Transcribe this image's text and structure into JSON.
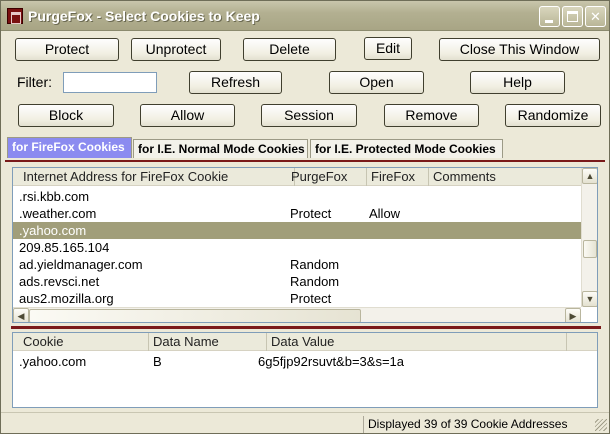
{
  "window": {
    "title": "PurgeFox - Select Cookies to Keep"
  },
  "toolbar_row1": [
    "Protect",
    "Unprotect",
    "Delete",
    "Edit",
    "Close This Window"
  ],
  "filter": {
    "label": "Filter:",
    "value": ""
  },
  "toolbar_row2": [
    "Refresh",
    "Open",
    "Help"
  ],
  "toolbar_row3": [
    "Block",
    "Allow",
    "Session",
    "Remove",
    "Randomize"
  ],
  "tabs": [
    "for FireFox Cookies",
    "for I.E. Normal Mode Cookies",
    "for I.E. Protected Mode Cookies"
  ],
  "cookie_list": {
    "columns": [
      "Internet Address for FireFox Cookie",
      "PurgeFox",
      "FireFox",
      "Comments"
    ],
    "rows": [
      {
        "address": ".rsi.kbb.com",
        "purgefox": "",
        "firefox": ""
      },
      {
        "address": ".weather.com",
        "purgefox": "Protect",
        "firefox": "Allow"
      },
      {
        "address": ".yahoo.com",
        "purgefox": "",
        "firefox": "",
        "selected": true
      },
      {
        "address": "209.85.165.104",
        "purgefox": "",
        "firefox": ""
      },
      {
        "address": "ad.yieldmanager.com",
        "purgefox": "Random",
        "firefox": ""
      },
      {
        "address": "ads.revsci.net",
        "purgefox": "Random",
        "firefox": ""
      },
      {
        "address": "aus2.mozilla.org",
        "purgefox": "Protect",
        "firefox": ""
      }
    ]
  },
  "detail_list": {
    "columns": [
      "Cookie",
      "Data Name",
      "Data Value"
    ],
    "rows": [
      {
        "cookie": ".yahoo.com",
        "name": "B",
        "value": "6g5fjp92rsuvt&b=3&s=1a"
      }
    ]
  },
  "status": {
    "text": "Displayed 39 of 39 Cookie Addresses"
  },
  "scrollbar_glyphs": {
    "up": "▲",
    "down": "▼",
    "left": "◀",
    "right": "▶"
  },
  "colors": {
    "active_tab": "#8b8bf0",
    "selected_row": "#a19e7a",
    "separator": "#7a1a1a"
  }
}
